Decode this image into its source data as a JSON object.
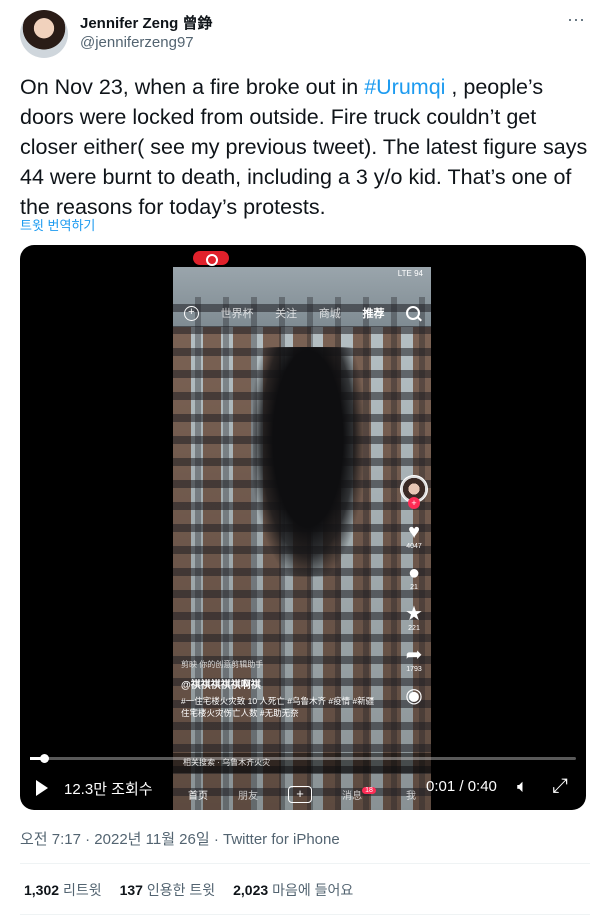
{
  "author": {
    "name": "Jennifer Zeng 曾錚",
    "handle": "@jenniferzeng97"
  },
  "menu_icon": "more-dots-icon",
  "tweet": {
    "text_before": "On Nov 23, when a fire broke out in ",
    "hashtag": "#Urumqi",
    "text_after": " , people’s doors were locked from outside. Fire truck couldn’t get closer either( see my previous tweet). The latest figure says 44 were burnt to death, including a 3 y/o kid. That’s one of the reasons for today’s protests.",
    "translate_label": "트윗 번역하기"
  },
  "video": {
    "phone_status": "LTE 94",
    "top_tabs": [
      "世界杯",
      "关注",
      "商城",
      "推荐"
    ],
    "selected_tab": "推荐",
    "side_counts": {
      "likes": "4047",
      "comments": "21",
      "favorites": "221",
      "shares": "1793"
    },
    "capcut": "剪映  你的创意剪辑助手",
    "author": "@祺祺祺祺祺啊祺",
    "description": "#一住宅楼火灾致 10 人死亡 #乌鲁木齐 #疫情 #新疆住宅楼火灾伤亡人数 #无助无奈",
    "related_search": "相关搜索 · 乌鲁木齐火灾",
    "bottom_nav": [
      "首页",
      "朋友",
      "消息",
      "我"
    ],
    "messages_badge": "18",
    "progress_fraction": 0.025,
    "views": "12.3만 조회수",
    "time": "0:01 / 0:40"
  },
  "meta": {
    "timestamp": "오전 7:17 · 2022년 11월 26일 · Twitter for iPhone"
  },
  "stats": {
    "retweets_count": "1,302",
    "retweets_label": "리트윗",
    "quotes_count": "137",
    "quotes_label": "인용한 트윗",
    "likes_count": "2,023",
    "likes_label": "마음에 들어요"
  }
}
